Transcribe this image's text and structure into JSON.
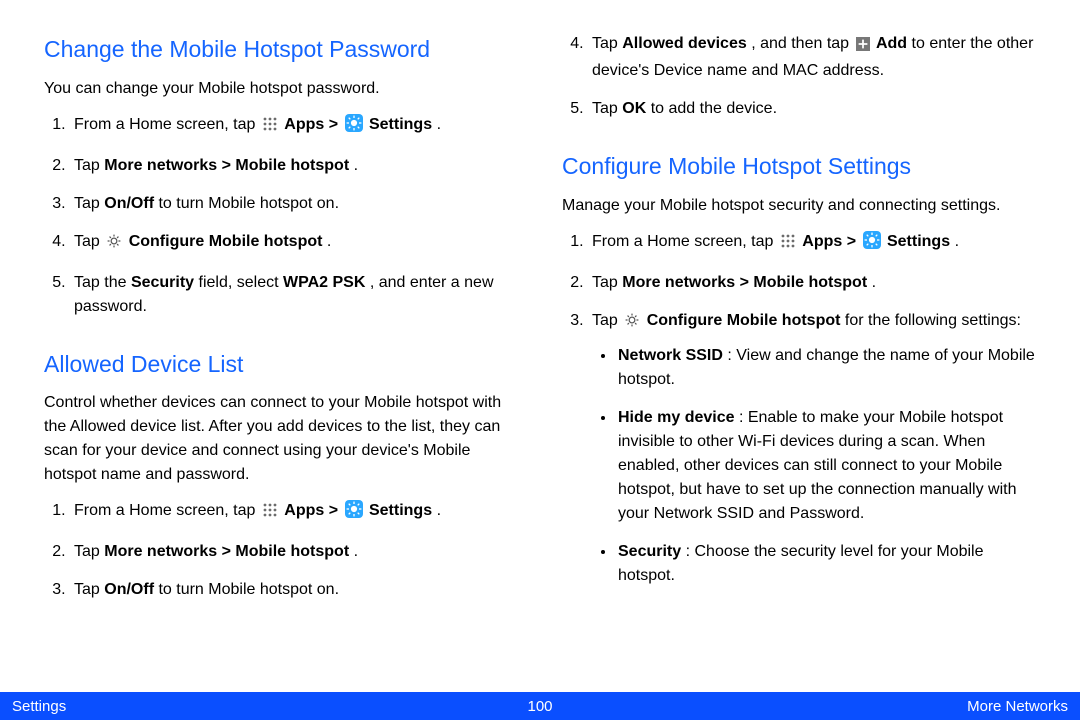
{
  "left": {
    "section_a": {
      "title": "Change the Mobile Hotspot Password",
      "lead": "You can change your Mobile hotspot password.",
      "s1_a": "From a Home screen, tap ",
      "s1_apps": "Apps > ",
      "s1_settings": " Settings",
      "s1_end": " .",
      "s2_a": "Tap ",
      "s2_b": "More networks > Mobile hotspot",
      "s2_c": ".",
      "s3_a": "Tap ",
      "s3_b": "On/Off",
      "s3_c": " to turn Mobile hotspot on.",
      "s4_a": "Tap ",
      "s4_b": "Configure Mobile hotspot",
      "s4_c": ".",
      "s5_a": "Tap the ",
      "s5_b": "Security",
      "s5_c": " field, select ",
      "s5_d": "WPA2 PSK",
      "s5_e": ", and enter a new password."
    },
    "section_b": {
      "title": "Allowed Device List",
      "lead": "Control whether devices can connect to your Mobile hotspot with the Allowed device list. After you add devices to the list, they can scan for your device and connect using your device's Mobile hotspot name and password.",
      "s1_a": "From a Home screen, tap ",
      "s1_apps": "Apps > ",
      "s1_settings": " Settings",
      "s1_end": " .",
      "s2_a": "Tap ",
      "s2_b": "More networks > Mobile hotspot",
      "s2_c": ".",
      "s3_a": "Tap ",
      "s3_b": "On/Off",
      "s3_c": " to turn Mobile hotspot on."
    }
  },
  "right": {
    "cont": {
      "s4_a": "Tap ",
      "s4_b": "Allowed devices",
      "s4_c": ", and then tap ",
      "s4_add": "Add",
      "s4_d": " to enter the other device's Device name and MAC address.",
      "s5_a": "Tap ",
      "s5_b": "OK",
      "s5_c": " to add the device."
    },
    "section_c": {
      "title": "Configure Mobile Hotspot Settings",
      "lead": "Manage your Mobile hotspot security and connecting settings.",
      "s1_a": "From a Home screen, tap ",
      "s1_apps": "Apps > ",
      "s1_settings": " Settings",
      "s1_end": " .",
      "s2_a": "Tap ",
      "s2_b": "More networks > Mobile hotspot",
      "s2_c": ".",
      "s3_a": "Tap ",
      "s3_b": "Configure Mobile hotspot",
      "s3_c": " for the following settings:",
      "b1_a": "Network SSID",
      "b1_b": ": View and change the name of your Mobile hotspot.",
      "b2_a": "Hide my device",
      "b2_b": ": Enable to make your Mobile hotspot invisible to other Wi-Fi devices during a scan. When enabled, other devices can still connect to your Mobile hotspot, but have to set up the connection manually with your Network SSID and Password.",
      "b3_a": "Security",
      "b3_b": ": Choose the security level for your Mobile hotspot."
    }
  },
  "footer": {
    "left": "Settings",
    "center": "100",
    "right": "More Networks"
  }
}
